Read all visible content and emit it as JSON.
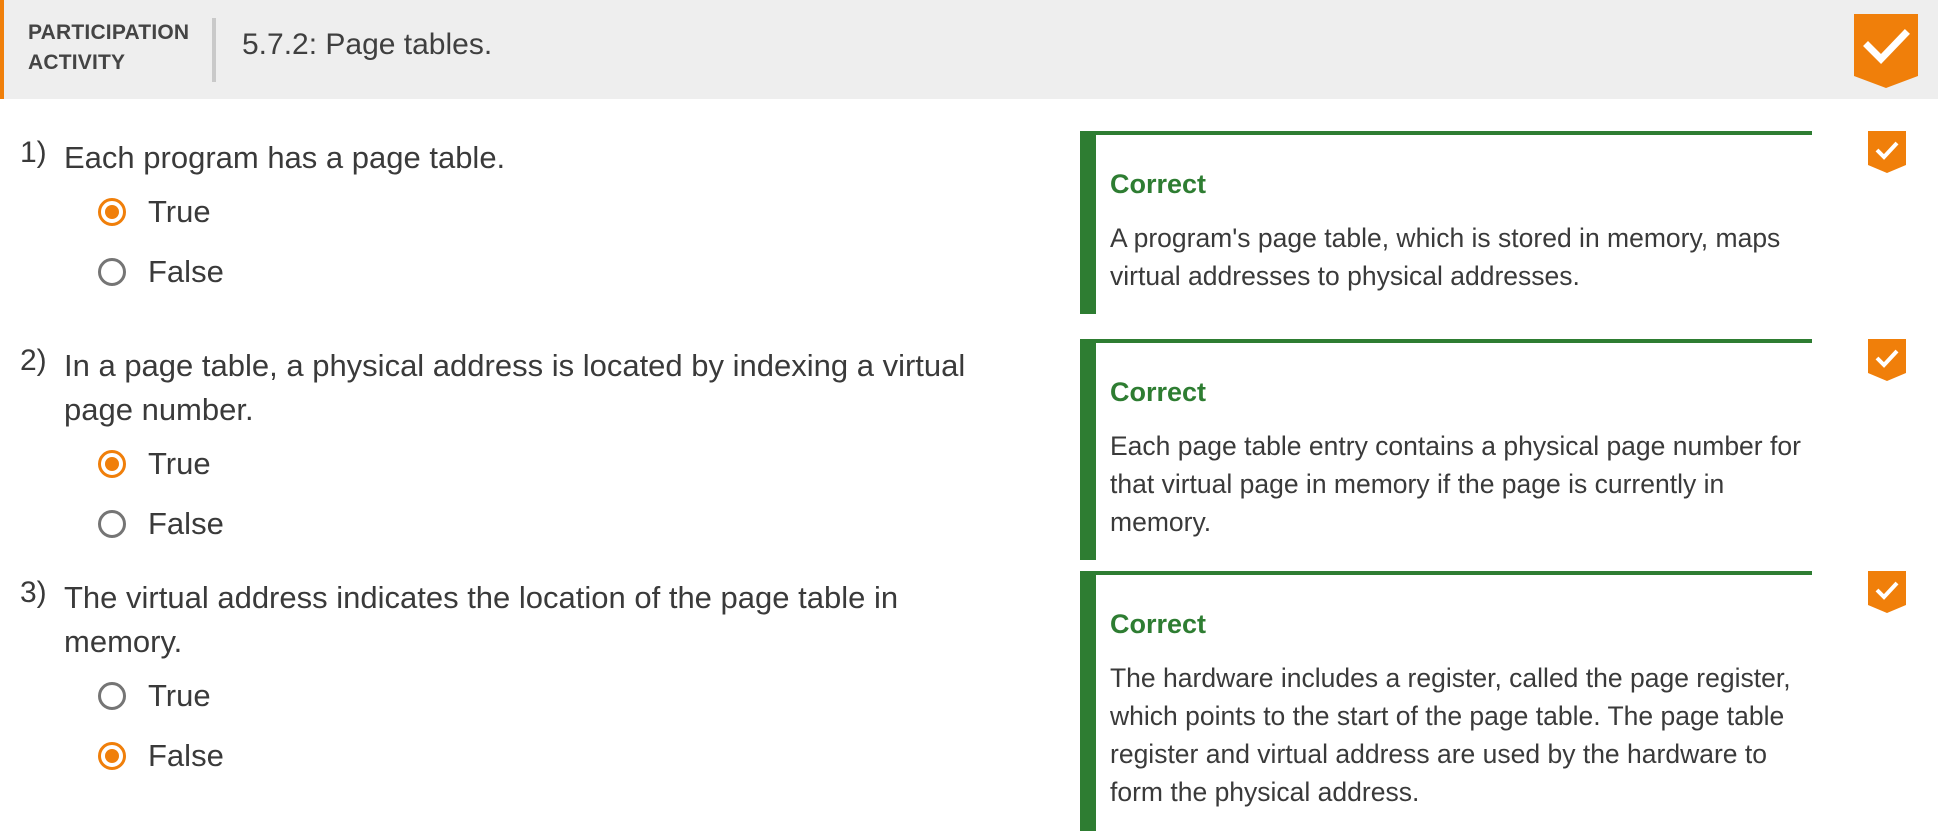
{
  "header": {
    "label_line1": "PARTICIPATION",
    "label_line2": "ACTIVITY",
    "title": "5.7.2: Page tables.",
    "badge_icon": "checkmark-icon",
    "accent_color": "#f07f0a"
  },
  "questions": [
    {
      "number": "1)",
      "text": "Each program has a page table.",
      "options": [
        "True",
        "False"
      ],
      "selected": "True",
      "feedback_status": "Correct",
      "feedback_text": "A program's page table, which is stored in memory, maps virtual addresses to physical addresses."
    },
    {
      "number": "2)",
      "text": "In a page table, a physical address is located by indexing a virtual page number.",
      "options": [
        "True",
        "False"
      ],
      "selected": "True",
      "feedback_status": "Correct",
      "feedback_text": "Each page table entry contains a physical page number for that virtual page in memory if the page is currently in memory."
    },
    {
      "number": "3)",
      "text": "The virtual address indicates the location of the page table in memory.",
      "options": [
        "True",
        "False"
      ],
      "selected": "False",
      "feedback_status": "Correct",
      "feedback_text": "The hardware includes a register, called the page register, which points to the start of the page table. The page table register and virtual address are used by the hardware to form the physical address."
    }
  ],
  "colors": {
    "correct_green": "#2e7d32",
    "radio_selected": "#f07f0a",
    "radio_unselected": "#757575"
  }
}
